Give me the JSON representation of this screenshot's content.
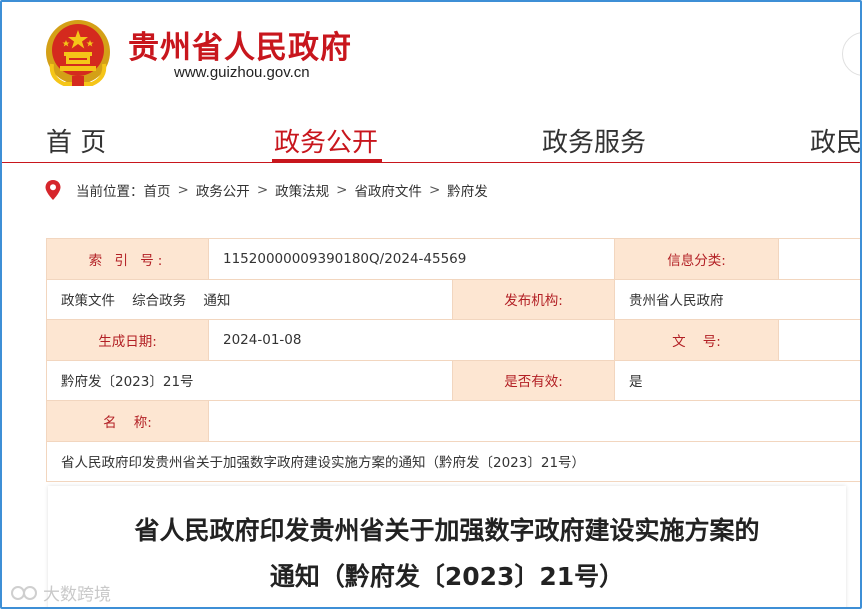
{
  "header": {
    "site_title": "贵州省人民政府",
    "site_url": "www.guizhou.gov.cn",
    "brand_color": "#c8161d"
  },
  "nav": {
    "items": [
      {
        "label": "首 页"
      },
      {
        "label": "政务公开",
        "active": true
      },
      {
        "label": "政务服务"
      },
      {
        "label": "政民"
      }
    ]
  },
  "breadcrumb": {
    "prefix": "当前位置：",
    "items": [
      "首页",
      "政务公开",
      "政策法规",
      "省政府文件",
      "黔府发"
    ],
    "separator": ">"
  },
  "info": {
    "index_label": "索 引 号:",
    "index_value": "11520000009390180Q/2024-45569",
    "category_label": "信息分类:",
    "category_value": "政策文件    综合政务    通知",
    "publisher_label": "发布机构:",
    "publisher_value": "贵州省人民政府",
    "date_label": "生成日期:",
    "date_value": "2024-01-08",
    "docno_label": "文    号:",
    "docno_value": "黔府发〔2023〕21号",
    "valid_label": "是否有效:",
    "valid_value": "是",
    "name_label": "名    称:",
    "name_value": "省人民政府印发贵州省关于加强数字政府建设实施方案的通知（黔府发〔2023〕21号）"
  },
  "document": {
    "title_line1": "省人民政府印发贵州省关于加强数字政府建设实施方案的",
    "title_line2": "通知（黔府发〔2023〕21号）"
  },
  "watermark": "大数跨境"
}
